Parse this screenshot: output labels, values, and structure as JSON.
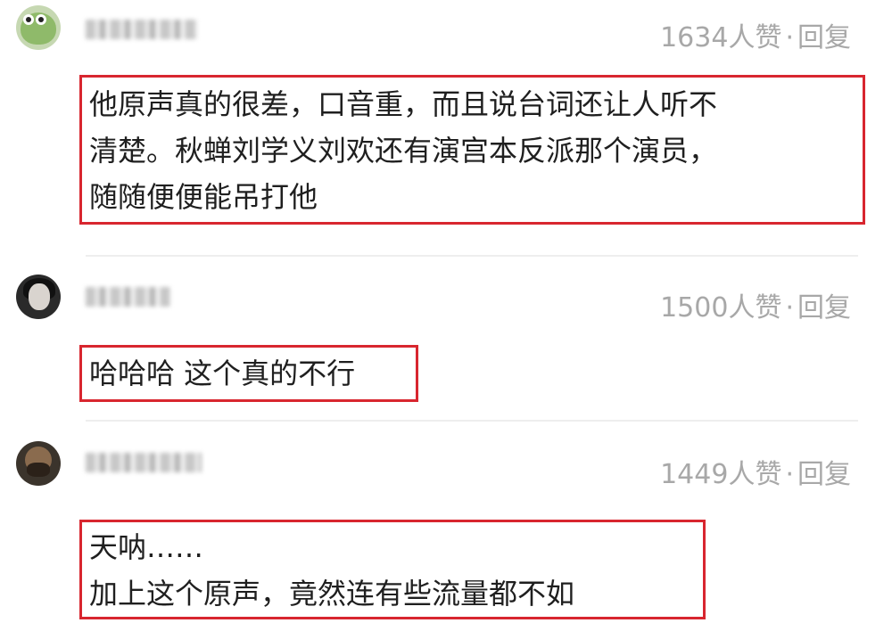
{
  "comments": [
    {
      "likes": "1634人赞",
      "separator": "·",
      "reply": "回复",
      "lines": [
        "他原声真的很差，口音重，而且说台词还让人听不",
        "清楚。秋蝉刘学义刘欢还有演宫本反派那个演员，",
        "随随便便能吊打他"
      ]
    },
    {
      "likes": "1500人赞",
      "separator": "·",
      "reply": "回复",
      "lines": [
        "哈哈哈 这个真的不行"
      ]
    },
    {
      "likes": "1449人赞",
      "separator": "·",
      "reply": "回复",
      "lines": [
        "天呐……",
        "加上这个原声，竟然连有些流量都不如"
      ]
    }
  ]
}
